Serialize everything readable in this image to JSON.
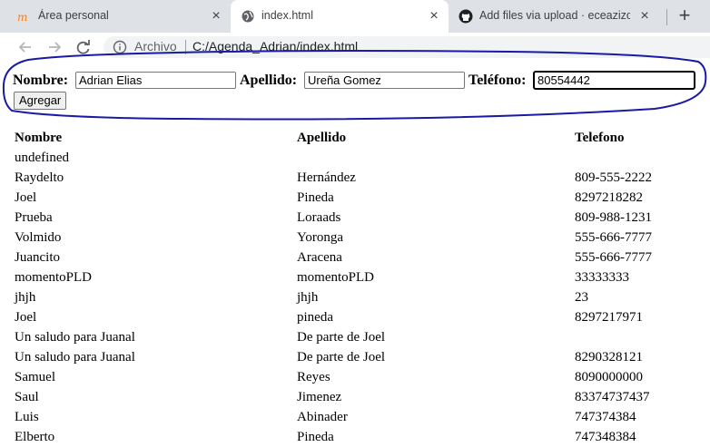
{
  "browser": {
    "tabs": [
      {
        "title": "Área personal"
      },
      {
        "title": "index.html"
      },
      {
        "title": "Add files via upload · eceazizoglu"
      }
    ],
    "address": {
      "scheme_label": "Archivo",
      "url": "C:/Agenda_Adrian/index.html"
    }
  },
  "form": {
    "nombre_label": "Nombre:",
    "nombre_value": "Adrian Elias",
    "apellido_label": "Apellido:",
    "apellido_value": "Ureña Gomez",
    "telefono_label": "Teléfono:",
    "telefono_value": "80554442",
    "agregar_label": "Agregar"
  },
  "table": {
    "headers": [
      "Nombre",
      "Apellido",
      "Telefono"
    ],
    "rows": [
      [
        "undefined",
        "",
        ""
      ],
      [
        "Raydelto",
        "Hernández",
        "809-555-2222"
      ],
      [
        "Joel",
        "Pineda",
        "8297218282"
      ],
      [
        "Prueba",
        "Loraads",
        "809-988-1231"
      ],
      [
        "Volmido",
        "Yoronga",
        "555-666-7777"
      ],
      [
        "Juancito",
        "Aracena",
        "555-666-7777"
      ],
      [
        "momentoPLD",
        "momentoPLD",
        "33333333"
      ],
      [
        "jhjh",
        "jhjh",
        "23"
      ],
      [
        "Joel",
        "pineda",
        "8297217971"
      ],
      [
        "Un saludo para Juanal",
        "De parte de Joel",
        ""
      ],
      [
        "Un saludo para Juanal",
        "De parte de Joel",
        "8290328121"
      ],
      [
        "Samuel",
        "Reyes",
        "8090000000"
      ],
      [
        "Saul",
        "Jimenez",
        "83374737437"
      ],
      [
        "Luis",
        "Abinader",
        "747374384"
      ],
      [
        "Elberto",
        "Pineda",
        "747348384"
      ]
    ]
  },
  "colors": {
    "annotation": "#1a1aa6",
    "tabbar": "#dee1e6"
  }
}
